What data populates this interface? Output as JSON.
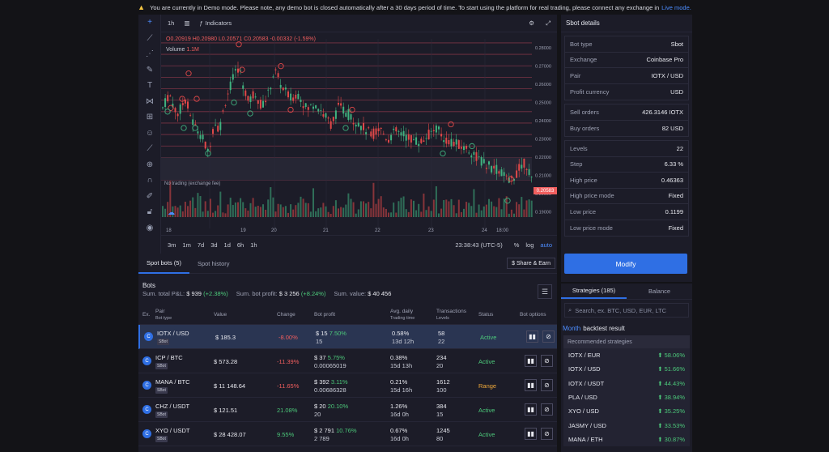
{
  "banner": {
    "text": "You are currently in Demo mode. Please note, any demo bot is closed automatically after a 30 days period of time. To start using the platform for real trading, please connect any exchange in",
    "link": "Live mode."
  },
  "chart": {
    "interval": "1h",
    "indicators_label": "Indicators",
    "ohlc": {
      "o": "O0.20919",
      "h": "H0.20980",
      "l": "L0.20571",
      "c": "C0.20583",
      "chg": "-0.00332 (-1.59%)"
    },
    "volume_label": "Volume",
    "volume_value": "1.1M",
    "no_trading": "No trading (exchange fee)",
    "price_ticks": [
      "0.28000",
      "0.27000",
      "0.26000",
      "0.25000",
      "0.24000",
      "0.23000",
      "0.22000",
      "0.21000",
      "0.20000",
      "0.19000"
    ],
    "price_tag": "0.20583",
    "date_ticks": [
      "18",
      "19",
      "20",
      "21",
      "22",
      "23",
      "24",
      "18:00"
    ],
    "timeframes": [
      "3m",
      "1m",
      "7d",
      "3d",
      "1d",
      "6h",
      "1h"
    ],
    "clock": "23:38:43 (UTC-5)",
    "pct": "%",
    "log": "log",
    "auto": "auto"
  },
  "sbot": {
    "title": "Sbot details",
    "group1": [
      {
        "k": "Bot type",
        "v": "Sbot"
      },
      {
        "k": "Exchange",
        "v": "Coinbase Pro"
      },
      {
        "k": "Pair",
        "v": "IOTX / USD"
      },
      {
        "k": "Profit currency",
        "v": "USD"
      }
    ],
    "group2": [
      {
        "k": "Sell orders",
        "v": "426.3146 IOTX"
      },
      {
        "k": "Buy orders",
        "v": "82 USD"
      }
    ],
    "group3": [
      {
        "k": "Levels",
        "v": "22"
      },
      {
        "k": "Step",
        "v": "6.33 %"
      },
      {
        "k": "High price",
        "v": "0.46363"
      },
      {
        "k": "High price mode",
        "v": "Fixed"
      },
      {
        "k": "Low price",
        "v": "0.1199"
      },
      {
        "k": "Low price mode",
        "v": "Fixed"
      }
    ],
    "modify": "Modify"
  },
  "strategies": {
    "tab1": "Strategies (185)",
    "tab2": "Balance",
    "search_placeholder": "Search, ex. BTC, USD, EUR, LTC",
    "month": "Month",
    "backtest": "backtest result",
    "rec_header": "Recommended strategies",
    "items": [
      {
        "n": "IOTX / EUR",
        "p": "58.06%"
      },
      {
        "n": "IOTX / USD",
        "p": "51.66%"
      },
      {
        "n": "IOTX / USDT",
        "p": "44.43%"
      },
      {
        "n": "PLA / USD",
        "p": "38.94%"
      },
      {
        "n": "XYO / USD",
        "p": "35.25%"
      },
      {
        "n": "JASMY / USD",
        "p": "33.53%"
      },
      {
        "n": "MANA / ETH",
        "p": "30.87%"
      }
    ]
  },
  "bots": {
    "tab1": "Spot bots (5)",
    "tab2": "Spot history",
    "share": "Share & Earn",
    "title": "Bots",
    "sum_pnl_label": "Sum. total P&L:",
    "sum_pnl": "$ 939",
    "sum_pnl_pct": "(+2.38%)",
    "sum_bp_label": "Sum. bot profit:",
    "sum_bp": "$ 3 256",
    "sum_bp_pct": "(+8.24%)",
    "sum_val_label": "Sum. value:",
    "sum_val": "$ 40 456",
    "headers": {
      "ex": "Ex.",
      "pair": "Pair",
      "bot_type": "Bot type",
      "value": "Value",
      "change": "Change",
      "bot_profit": "Bot profit",
      "avg": "Avg. daily",
      "trading_time": "Trading time",
      "tx": "Transactions",
      "levels": "Levels",
      "status": "Status",
      "options": "Bot options"
    },
    "rows": [
      {
        "pair": "IOTX / USD",
        "badge": "SBot",
        "value": "$ 185.3",
        "change": "-8.00%",
        "bp": "$ 15",
        "bp_pct": "7.50%",
        "bp2": "15",
        "avg": "0.58%",
        "time": "13d 12h",
        "tx": "58",
        "lv": "22",
        "status": "Active"
      },
      {
        "pair": "ICP / BTC",
        "badge": "SBot",
        "value": "$ 573.28",
        "change": "-11.39%",
        "bp": "$ 37",
        "bp_pct": "5.75%",
        "bp2": "0.00065019",
        "avg": "0.38%",
        "time": "15d 13h",
        "tx": "234",
        "lv": "20",
        "status": "Active"
      },
      {
        "pair": "MANA / BTC",
        "badge": "SBot",
        "value": "$ 11 148.64",
        "change": "-11.65%",
        "bp": "$ 392",
        "bp_pct": "3.11%",
        "bp2": "0.00686328",
        "avg": "0.21%",
        "time": "15d 16h",
        "tx": "1612",
        "lv": "100",
        "status": "Range"
      },
      {
        "pair": "CHZ / USDT",
        "badge": "SBot",
        "value": "$ 121.51",
        "change": "21.08%",
        "bp": "$ 20",
        "bp_pct": "20.10%",
        "bp2": "20",
        "avg": "1.26%",
        "time": "16d 0h",
        "tx": "384",
        "lv": "15",
        "status": "Active"
      },
      {
        "pair": "XYO / USDT",
        "badge": "SBot",
        "value": "$ 28 428.07",
        "change": "9.55%",
        "bp": "$ 2 791",
        "bp_pct": "10.76%",
        "bp2": "2 789",
        "avg": "0.67%",
        "time": "16d 0h",
        "tx": "1245",
        "lv": "80",
        "status": "Active"
      }
    ]
  }
}
